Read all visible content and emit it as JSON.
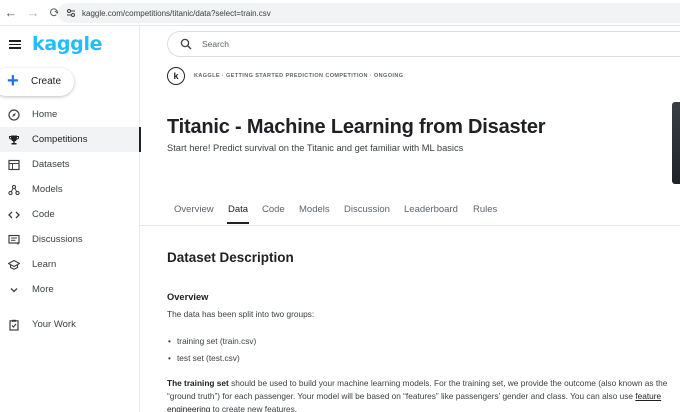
{
  "browser": {
    "url": "kaggle.com/competitions/titanic/data?select=train.csv"
  },
  "sidebar": {
    "logo": "kaggle",
    "create_label": "Create",
    "items": [
      {
        "label": "Home",
        "icon": "compass-icon"
      },
      {
        "label": "Competitions",
        "icon": "trophy-icon",
        "active": true
      },
      {
        "label": "Datasets",
        "icon": "table-icon"
      },
      {
        "label": "Models",
        "icon": "models-icon"
      },
      {
        "label": "Code",
        "icon": "code-icon"
      },
      {
        "label": "Discussions",
        "icon": "comment-icon"
      },
      {
        "label": "Learn",
        "icon": "school-icon"
      },
      {
        "label": "More",
        "icon": "chevron-down-icon"
      },
      {
        "label": "Your Work",
        "icon": "clipboard-icon"
      }
    ]
  },
  "search": {
    "placeholder": "Search"
  },
  "competition": {
    "badge_letter": "k",
    "meta": "KAGGLE · GETTING STARTED PREDICTION COMPETITION · ONGOING",
    "title": "Titanic - Machine Learning from Disaster",
    "subtitle": "Start here! Predict survival on the Titanic and get familiar with ML basics"
  },
  "tabs": [
    "Overview",
    "Data",
    "Code",
    "Models",
    "Discussion",
    "Leaderboard",
    "Rules"
  ],
  "active_tab": "Data",
  "content": {
    "section_title": "Dataset Description",
    "overview_title": "Overview",
    "intro": "The data has been split into two groups:",
    "bullets": [
      "training set (train.csv)",
      "test set (test.csv)"
    ],
    "para_bold": "The training set",
    "para_line1": " should be used to build your machine learning models. For the training set, we provide the outcome (also known as the",
    "para_line2_a": "“ground truth”) for each passenger. Your model will be based on “features” like passengers’ gender and class. You can also use ",
    "para_link_a": "feature",
    "para_link_b": "engineering",
    "para_line3": " to create new features."
  },
  "colors": {
    "brand": "#20beff",
    "accent_blue": "#1a73e8",
    "text": "#202124"
  }
}
